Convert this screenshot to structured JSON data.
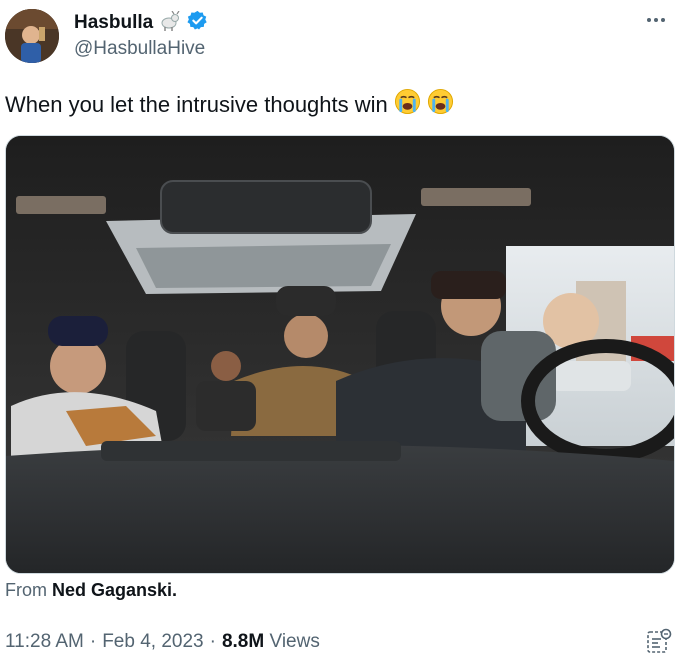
{
  "author": {
    "display_name": "Hasbulla",
    "handle": "@HasbullaHive",
    "name_emoji": "goat",
    "verified": true,
    "verified_color": "#1d9bf0"
  },
  "tweet": {
    "text": "When you let the intrusive thoughts win",
    "emojis": [
      "loudly-crying-face",
      "loudly-crying-face"
    ]
  },
  "media": {
    "description_icon": "video-thumbnail"
  },
  "credit": {
    "prefix": "From",
    "name": "Ned Gaganski."
  },
  "meta": {
    "time": "11:28 AM",
    "sep1": "·",
    "date": "Feb 4, 2023",
    "sep2": "·",
    "views_count": "8.8M",
    "views_label": "Views"
  },
  "colors": {
    "text_primary": "#0f1419",
    "text_secondary": "#536471",
    "border": "#cfd9de"
  }
}
